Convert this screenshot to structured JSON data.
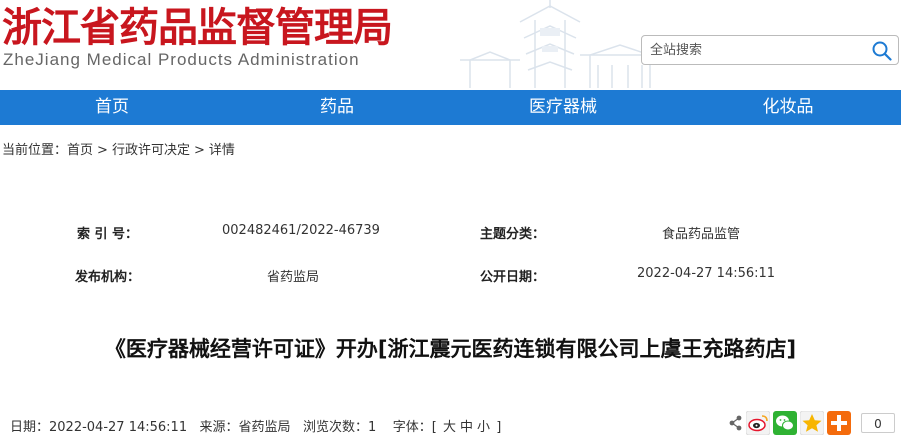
{
  "header": {
    "site_title": "浙江省药品监督管理局",
    "site_subtitle": "ZheJiang Medical Products Administration",
    "search_placeholder": "全站搜索"
  },
  "nav": {
    "items": [
      {
        "label": "首页"
      },
      {
        "label": "药品"
      },
      {
        "label": "医疗器械"
      },
      {
        "label": "化妆品"
      }
    ]
  },
  "breadcrumb": {
    "prefix": "当前位置：",
    "items": [
      "首页",
      "行政许可决定",
      "详情"
    ],
    "separator": ">"
  },
  "meta": {
    "index_label": "索 引 号：",
    "index_value": "002482461/2022-46739",
    "topic_label": "主题分类：",
    "topic_value": "食品药品监管",
    "publisher_label": "发布机构：",
    "publisher_value": "省药监局",
    "date_label": "公开日期：",
    "date_value": "2022-04-27 14:56:11"
  },
  "article": {
    "title": "《医疗器械经营许可证》开办[浙江震元医药连锁有限公司上虞王充路药店]"
  },
  "footer": {
    "date_label": "日期：",
    "date_value": "2022-04-27 14:56:11",
    "source_label": "来源：",
    "source_value": "省药监局",
    "views_label": "浏览次数：",
    "views_value": "1",
    "font_label": "字体：",
    "font_open": "[",
    "font_large": "大",
    "font_medium": "中",
    "font_small": "小",
    "font_close": "]"
  },
  "share": {
    "icons": [
      "share-icon",
      "weibo-icon",
      "wechat-icon",
      "qzone-icon",
      "add-icon"
    ],
    "count": "0"
  },
  "colors": {
    "title_red": "#c8161e",
    "nav_blue": "#1d7ad3"
  }
}
